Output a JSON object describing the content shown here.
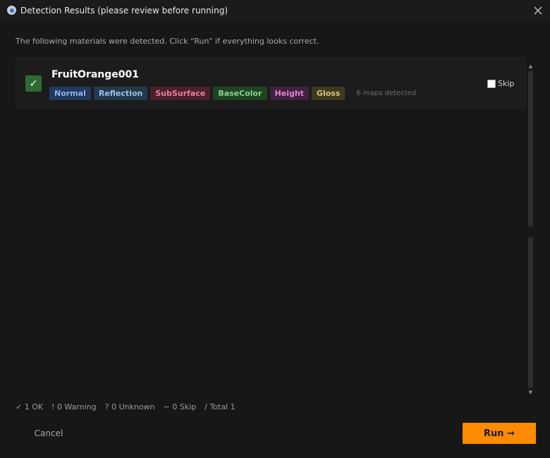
{
  "window": {
    "title": "Detection Results (please review before running)",
    "app_icon": "app-logo-icon",
    "close_icon": "close-icon"
  },
  "instruction": "The following materials were detected. Click “Run” if everything looks correct.",
  "materials": [
    {
      "name": "FruitOrange001",
      "status": "ok",
      "status_icon": "checkmark-icon",
      "status_glyph": "✓",
      "tags": [
        {
          "label": "Normal",
          "color": "#8eb2e6"
        },
        {
          "label": "Reflection",
          "color": "#9cc2e6"
        },
        {
          "label": "SubSurface",
          "color": "#e8849a"
        },
        {
          "label": "BaseColor",
          "color": "#86d28a"
        },
        {
          "label": "Height",
          "color": "#dc86cf"
        },
        {
          "label": "Gloss",
          "color": "#d8c478"
        }
      ],
      "maps_detected": "6 maps detected",
      "skip_label": "Skip",
      "skip_checked": false
    }
  ],
  "summary": {
    "ok": "✓ 1 OK",
    "warning": "! 0 Warning",
    "unknown": "? 0 Unknown",
    "skip": "− 0 Skip",
    "total": "/  Total 1"
  },
  "buttons": {
    "cancel": "Cancel",
    "run": "Run →"
  },
  "colors": {
    "accent": "#ff8b00",
    "ok": "#2d6b32",
    "background": "#171717"
  }
}
